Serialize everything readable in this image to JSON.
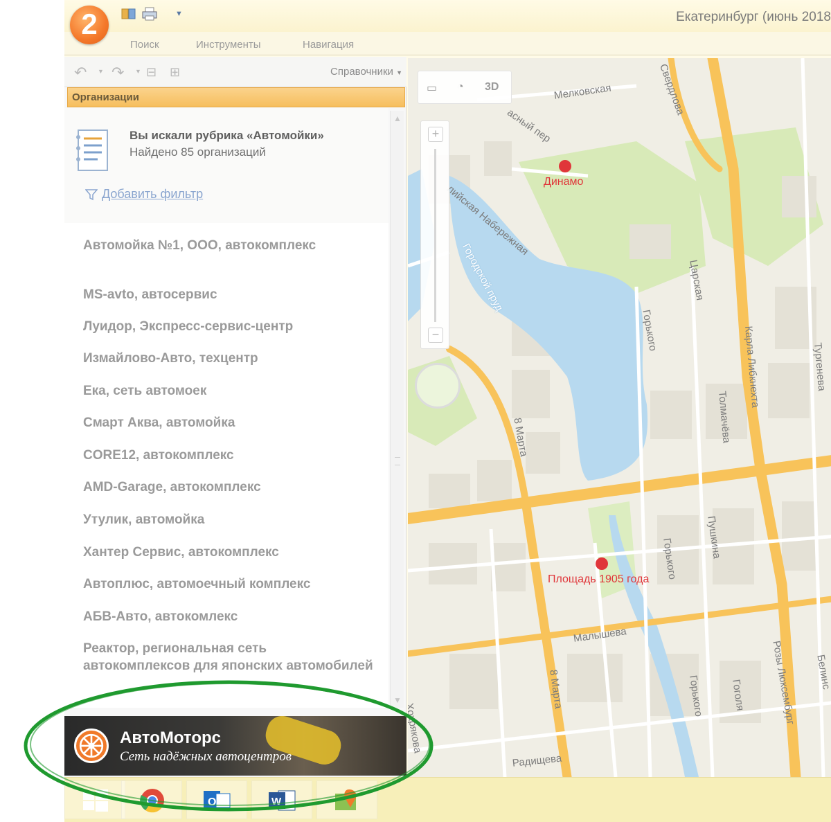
{
  "window": {
    "title": "Екатеринбург (июнь 2018"
  },
  "logo": {
    "text": "2"
  },
  "ribbon": {
    "tabs": [
      "Поиск",
      "Инструменты",
      "Навигация"
    ]
  },
  "toolbar": {
    "directories_label": "Справочники"
  },
  "panel": {
    "section_title": "Организации"
  },
  "search": {
    "title": "Вы искали рубрика «Автомойки»",
    "count": "Найдено 85 организаций",
    "add_filter": "Добавить фильтр"
  },
  "results": [
    {
      "name": "Автомойка №1, ООО, автокомплекс"
    },
    {
      "name": "MS-avto, автосервис"
    },
    {
      "name": "Луидор, Экспресс-сервис-центр"
    },
    {
      "name": "Измайлово-Авто, техцентр"
    },
    {
      "name": "Ека, сеть автомоек"
    },
    {
      "name": "Смарт Аква, автомойка"
    },
    {
      "name": "CORE12, автокомплекс"
    },
    {
      "name": "AMD-Garage, автокомплекс"
    },
    {
      "name": "Утулик, автомойка"
    },
    {
      "name": "Хантер Сервис, автокомплекс"
    },
    {
      "name": "Автоплюс, автомоечный комплекс"
    },
    {
      "name": "АБВ-Авто, автокомлекс"
    },
    {
      "name": "Реактор, региональная сеть автокомплексов для японских автомобилей"
    }
  ],
  "ad": {
    "title": "АвтоМоторс",
    "subtitle": "Сеть надёжных автоцентров"
  },
  "map": {
    "view_3d": "3D",
    "streets": {
      "melkovskaya": "Мелковская",
      "krasny_per": "асный пер",
      "sverdlova": "Свердлова",
      "naberezhnaya": "лийская Набережная",
      "gorodskoy_prud": "Городской пруд",
      "tsarskaya": "Царская",
      "gorkogo_1": "Горького",
      "tolmacheva": "Толмачёва",
      "karla_libknekhta": "Карла Либкнехта",
      "turgeneva": "Тургенева",
      "8_marta_1": "8 Марта",
      "pushkina": "Пушкина",
      "gorkogo_2": "Горького",
      "malysheva": "Малышева",
      "8_marta_2": "8 Марта",
      "gorkogo_3": "Горького",
      "gogolya": "Гоголя",
      "rozy_lyuksemburg": "Розы Люксембург",
      "belinskogo": "Белинс",
      "radishcheva": "Радищева",
      "khokhryakova": "Хохрякова"
    },
    "metro": {
      "dinamo": "Динамо",
      "ploshchad_1905": "Площадь 1905 года"
    }
  },
  "colors": {
    "accent_orange": "#f6be5e",
    "link_blue": "#8aa5cf",
    "road_yellow": "#f8c35a",
    "water_blue": "#b7d9ef",
    "park_green": "#d8eab8",
    "highlight_green": "#1f9a2f",
    "metro_red": "#e0363a"
  },
  "taskbar": {
    "apps": [
      "windows-start",
      "chrome",
      "outlook",
      "word",
      "2gis"
    ]
  }
}
